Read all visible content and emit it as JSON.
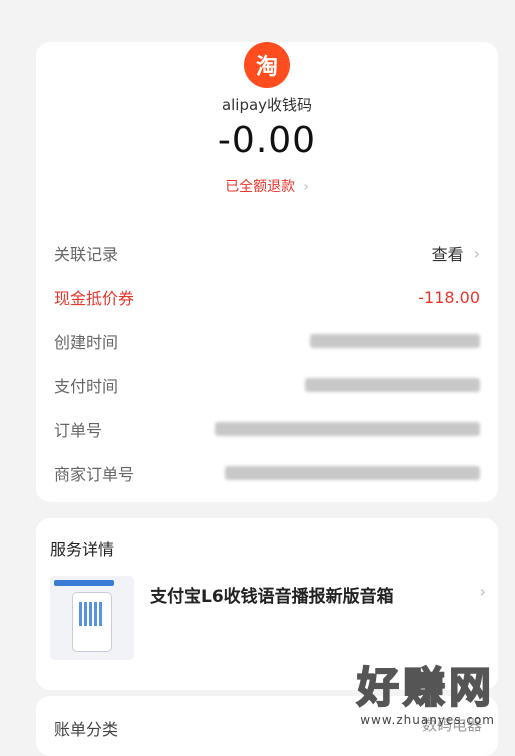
{
  "header": {
    "merchant_name": "alipay收钱码",
    "amount": "-0.00",
    "refund_status": "已全额退款",
    "logo_char": "淘"
  },
  "details": {
    "related_label": "关联记录",
    "related_value": "查看",
    "coupon_label": "现金抵价券",
    "coupon_value": "-118.00",
    "created_label": "创建时间",
    "paid_label": "支付时间",
    "order_label": "订单号",
    "merchant_order_label": "商家订单号"
  },
  "service": {
    "title": "服务详情",
    "product_name": "支付宝L6收钱语音播报新版音箱"
  },
  "bill": {
    "category_label": "账单分类",
    "category_value": "数码电器"
  },
  "watermark": {
    "logo_text": "好赚网",
    "url": "www.zhuanyes.com"
  },
  "colors": {
    "accent_red": "#e8362c",
    "logo_orange": "#ff4d1f"
  }
}
